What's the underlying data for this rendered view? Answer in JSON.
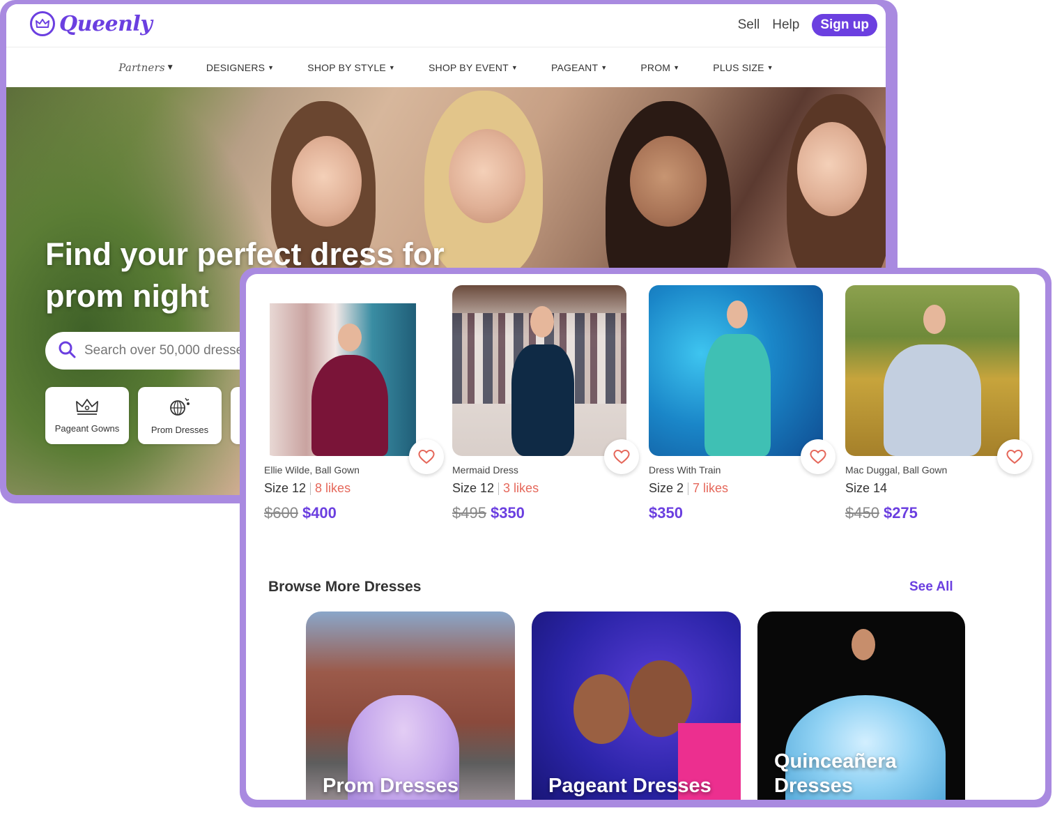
{
  "header": {
    "brand": "Queenly",
    "sell": "Sell",
    "help": "Help",
    "signup": "Sign up"
  },
  "nav": [
    {
      "label": "Partners"
    },
    {
      "label": "DESIGNERS"
    },
    {
      "label": "SHOP BY STYLE"
    },
    {
      "label": "SHOP BY EVENT"
    },
    {
      "label": "PAGEANT"
    },
    {
      "label": "PROM"
    },
    {
      "label": "PLUS SIZE"
    }
  ],
  "hero": {
    "title": "Find your perfect dress for prom night",
    "search_placeholder": "Search over 50,000 dresses",
    "categories": [
      {
        "label": "Pageant Gowns",
        "icon": "crown-icon"
      },
      {
        "label": "Prom Dresses",
        "icon": "disco-ball-icon"
      }
    ]
  },
  "listings": [
    {
      "title": "Ellie Wilde, Ball Gown",
      "size": "Size 12",
      "likes": "8 likes",
      "old_price": "$600",
      "price": "$400"
    },
    {
      "title": "Mermaid Dress",
      "size": "Size 12",
      "likes": "3 likes",
      "old_price": "$495",
      "price": "$350"
    },
    {
      "title": "Dress With Train",
      "size": "Size 2",
      "likes": "7 likes",
      "old_price": "",
      "price": "$350"
    },
    {
      "title": "Mac Duggal, Ball Gown",
      "size": "Size 14",
      "likes": "",
      "old_price": "$450",
      "price": "$275"
    }
  ],
  "browse": {
    "title": "Browse More Dresses",
    "see_all": "See All",
    "tiles": [
      {
        "label": "Prom Dresses"
      },
      {
        "label": "Pageant Dresses"
      },
      {
        "label": "Quinceañera Dresses"
      }
    ]
  },
  "colors": {
    "brand": "#6b3fe0",
    "frame": "#a98ae0",
    "likes": "#e5675a"
  }
}
